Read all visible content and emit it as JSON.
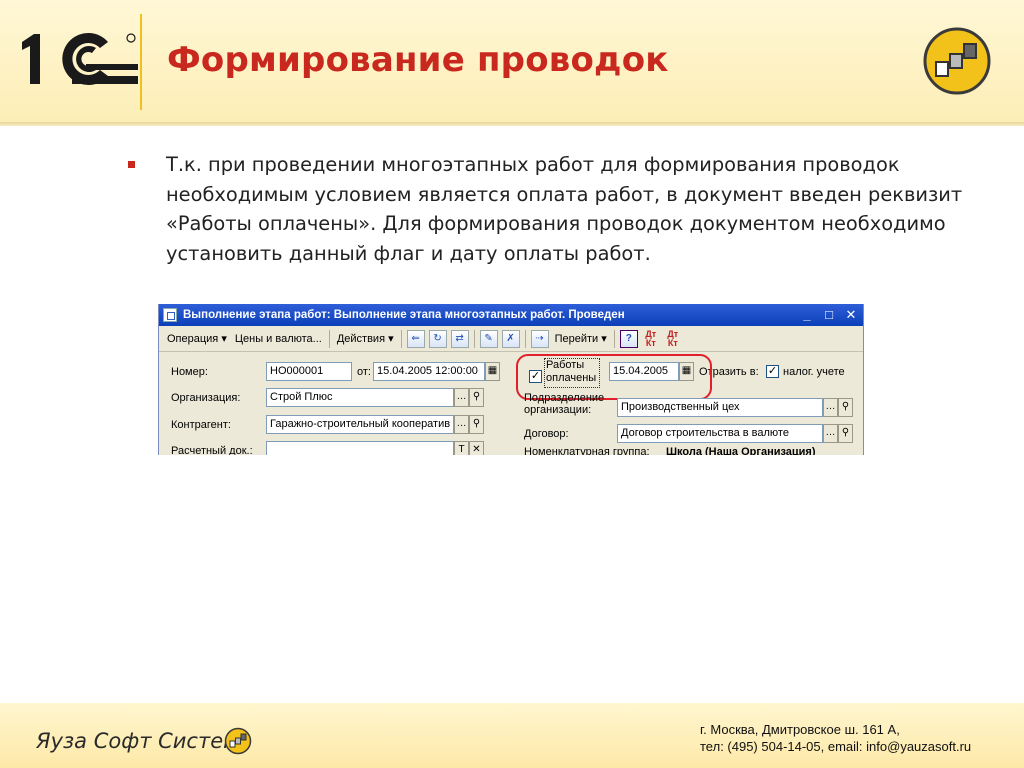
{
  "header": {
    "logo_text": "1С",
    "title": "Формирование проводок"
  },
  "body": {
    "paragraph": "Т.к. при проведении многоэтапных работ для формирования проводок необходимым условием является оплата работ, в документ введен реквизит «Работы оплачены». Для формирования проводок документом необходимо установить данный флаг и дату оплаты работ."
  },
  "screenshot": {
    "window_title": "Выполнение этапа работ: Выполнение этапа многоэтапных работ. Проведен",
    "window_buttons": [
      "_",
      "□",
      "✕"
    ],
    "toolbar": {
      "operation": "Операция ▾",
      "prices": "Цены и валюта...",
      "actions": "Действия ▾",
      "goto": "Перейти ▾",
      "help": "?",
      "dk1_top": "Дт",
      "dk1_bottom": "Кт",
      "dk2_top": "Дт",
      "dk2_bottom": "Кт"
    },
    "form": {
      "number_label": "Номер:",
      "number_value": "НО000001",
      "from_label": "от:",
      "date_value": "15.04.2005 12:00:00",
      "paid_label_1": "Работы",
      "paid_label_2": "оплачены",
      "paid_date": "15.04.2005",
      "reflect_label": "Отразить в:",
      "tax_label": "налог. учете",
      "org_label": "Организация:",
      "org_value": "Строй Плюс",
      "dept_label_1": "Подразделение",
      "dept_label_2": "организации:",
      "dept_value": "Производственный цех",
      "contractor_label": "Контрагент:",
      "contractor_value": "Гаражно-строительный кооператив '",
      "contract_label": "Договор:",
      "contract_value": "Договор строительства в валюте",
      "settlement_label": "Расчетный док.:",
      "settlement_value": "",
      "nomen_label": "Номенклатурная группа:",
      "nomen_value": "Школа (Наша Организация)"
    }
  },
  "footer": {
    "company": "Яуза Софт Системз",
    "address_line1": "г. Москва, Дмитровское ш. 161 А,",
    "address_line2": "тел: (495) 504-14-05, email: info@yauzasoft.ru"
  },
  "colors": {
    "title_red": "#c8281e",
    "accent_yellow": "#f0c020",
    "header_bg": "#fdeeb6",
    "highlight_ring": "#e0202a"
  }
}
